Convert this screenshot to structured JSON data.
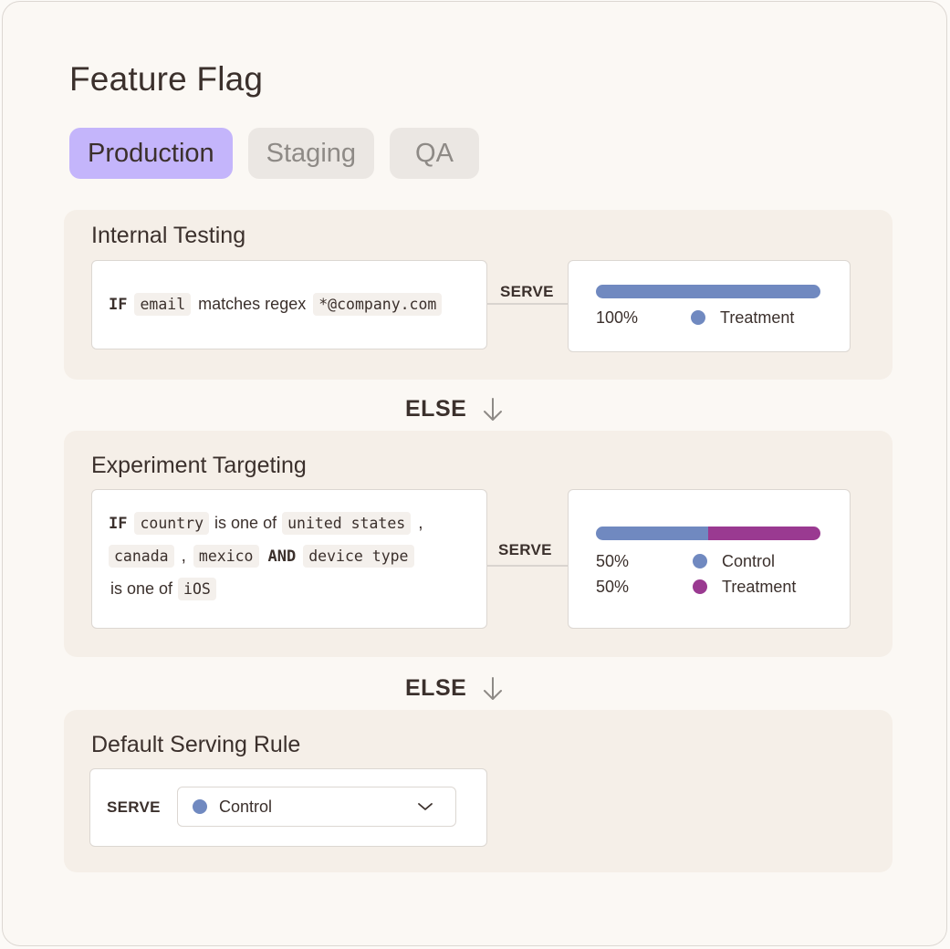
{
  "title": "Feature Flag",
  "tabs": [
    {
      "label": "Production",
      "active": true
    },
    {
      "label": "Staging",
      "active": false
    },
    {
      "label": "QA",
      "active": false
    }
  ],
  "colors": {
    "active_tab": "#c4b5fb",
    "control": "#7089c0",
    "treatment": "#9a3a91"
  },
  "rules": [
    {
      "title": "Internal Testing",
      "condition": {
        "if": "IF",
        "attribute": "email",
        "operator": "matches regex",
        "value": "*@company.com"
      },
      "serve_label": "SERVE",
      "split": [
        {
          "percent_label": "100%",
          "percent": 100,
          "variation": "Treatment",
          "color": "#7089c0"
        }
      ]
    },
    {
      "title": "Experiment Targeting",
      "condition": {
        "if": "IF",
        "attribute": "country",
        "operator": "is one of",
        "values": [
          "united states",
          "canada",
          "mexico"
        ],
        "separator": ",",
        "and": "AND",
        "attribute2": "device type",
        "operator2": "is one of",
        "value2": "iOS"
      },
      "serve_label": "SERVE",
      "split": [
        {
          "percent_label": "50%",
          "percent": 50,
          "variation": "Control",
          "color": "#7089c0"
        },
        {
          "percent_label": "50%",
          "percent": 50,
          "variation": "Treatment",
          "color": "#9a3a91"
        }
      ]
    }
  ],
  "else_label": "ELSE",
  "default_rule": {
    "title": "Default Serving Rule",
    "serve_label": "SERVE",
    "selected": "Control",
    "selected_color": "#7089c0"
  }
}
